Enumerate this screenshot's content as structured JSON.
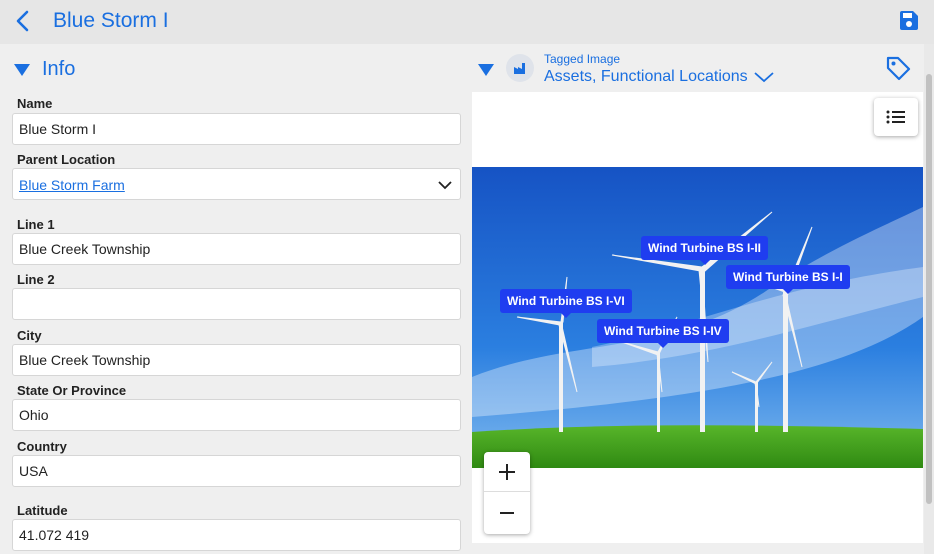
{
  "header": {
    "title": "Blue Storm I",
    "back_icon": "chevron-left-icon",
    "save_icon": "save-icon"
  },
  "info": {
    "section_title": "Info",
    "fields": {
      "name": {
        "label": "Name",
        "value": "Blue Storm I"
      },
      "parent_location": {
        "label": "Parent Location",
        "value": "Blue Storm Farm"
      },
      "line1": {
        "label": "Line 1",
        "value": "Blue Creek Township"
      },
      "line2": {
        "label": "Line 2",
        "value": ""
      },
      "city": {
        "label": "City",
        "value": "Blue Creek Township"
      },
      "state": {
        "label": "State Or Province",
        "value": "Ohio"
      },
      "country": {
        "label": "Country",
        "value": "USA"
      },
      "latitude": {
        "label": "Latitude",
        "value": "41.072 419"
      }
    }
  },
  "tagged_image": {
    "label": "Tagged Image",
    "value": "Assets, Functional Locations",
    "pins": [
      "Wind Turbine BS I-II",
      "Wind Turbine BS I-I",
      "Wind Turbine BS I-VI",
      "Wind Turbine BS I-IV"
    ]
  },
  "colors": {
    "accent": "#1a6fe0",
    "pin": "#1f3df0",
    "sky": "#1c63c9",
    "grass": "#3d9e1c"
  }
}
